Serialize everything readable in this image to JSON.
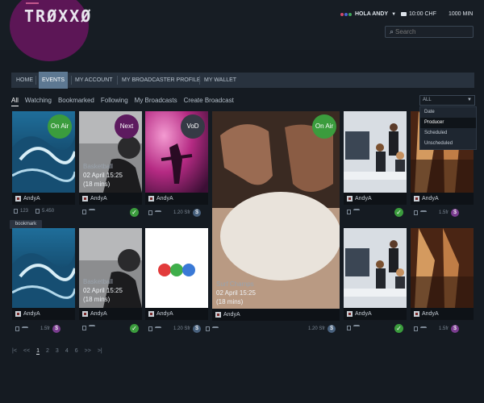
{
  "brand": {
    "logo_text": "TRØXXØ"
  },
  "header": {
    "greeting": "HOLA ANDY",
    "balance": "10:00 CHF",
    "minutes": "1000 MIN",
    "search_placeholder": "Search"
  },
  "nav": {
    "items": [
      "HOME",
      "EVENTS",
      "MY ACCOUNT",
      "MY BROADCASTER PROFILE",
      "MY WALLET"
    ],
    "active": "EVENTS"
  },
  "subtabs": {
    "items": [
      "All",
      "Watching",
      "Bookmarked",
      "Following",
      "My Broadcasts",
      "Create Broadcast"
    ],
    "active": "All"
  },
  "filter": {
    "selected": "ALL",
    "options": [
      "Date",
      "Producer",
      "Scheduled",
      "Unscheduled"
    ],
    "highlighted": "Producer"
  },
  "cards_row1": [
    {
      "badge": "On Air",
      "user": "AndyA",
      "views": "123",
      "size": "5.450"
    },
    {
      "badge": "Next",
      "title": "Basketball",
      "date": "02 April 15:25",
      "duration": "(18 mins)",
      "user": "AndyA"
    },
    {
      "badge": "VoD",
      "user": "AndyA",
      "size": "1.20 Sfr"
    },
    {
      "badge": "On Air",
      "user": "",
      "size": ""
    },
    {
      "user": "AndyA"
    },
    {
      "user": "AndyA",
      "size": "1.5fr"
    }
  ],
  "cards_row2": [
    {
      "user": "AndyA",
      "size": "1.5fr"
    },
    {
      "title": "Basketball",
      "date": "02 April 15:25",
      "duration": "(18 mins)",
      "user": "AndyA"
    },
    {
      "user": "AndyA",
      "size": "1.20 Sfr"
    },
    {
      "title": "Surf Champs",
      "date": "02 April 15:25",
      "duration": "(18 mins)",
      "user": "AndyA",
      "size": "1.20 Sfr"
    },
    {
      "user": "AndyA"
    },
    {
      "user": "AndyA",
      "size": "1.5fr"
    }
  ],
  "tooltip": "bookmark",
  "pagination": {
    "first": "|<",
    "prev": "<<",
    "pages": [
      "1",
      "2",
      "3",
      "4",
      "6"
    ],
    "current": "1",
    "next": ">>",
    "last": ">|"
  },
  "colors": {
    "purple": "#5c1656",
    "onair": "#3b9c3d",
    "nav_active": "#5d7892"
  }
}
